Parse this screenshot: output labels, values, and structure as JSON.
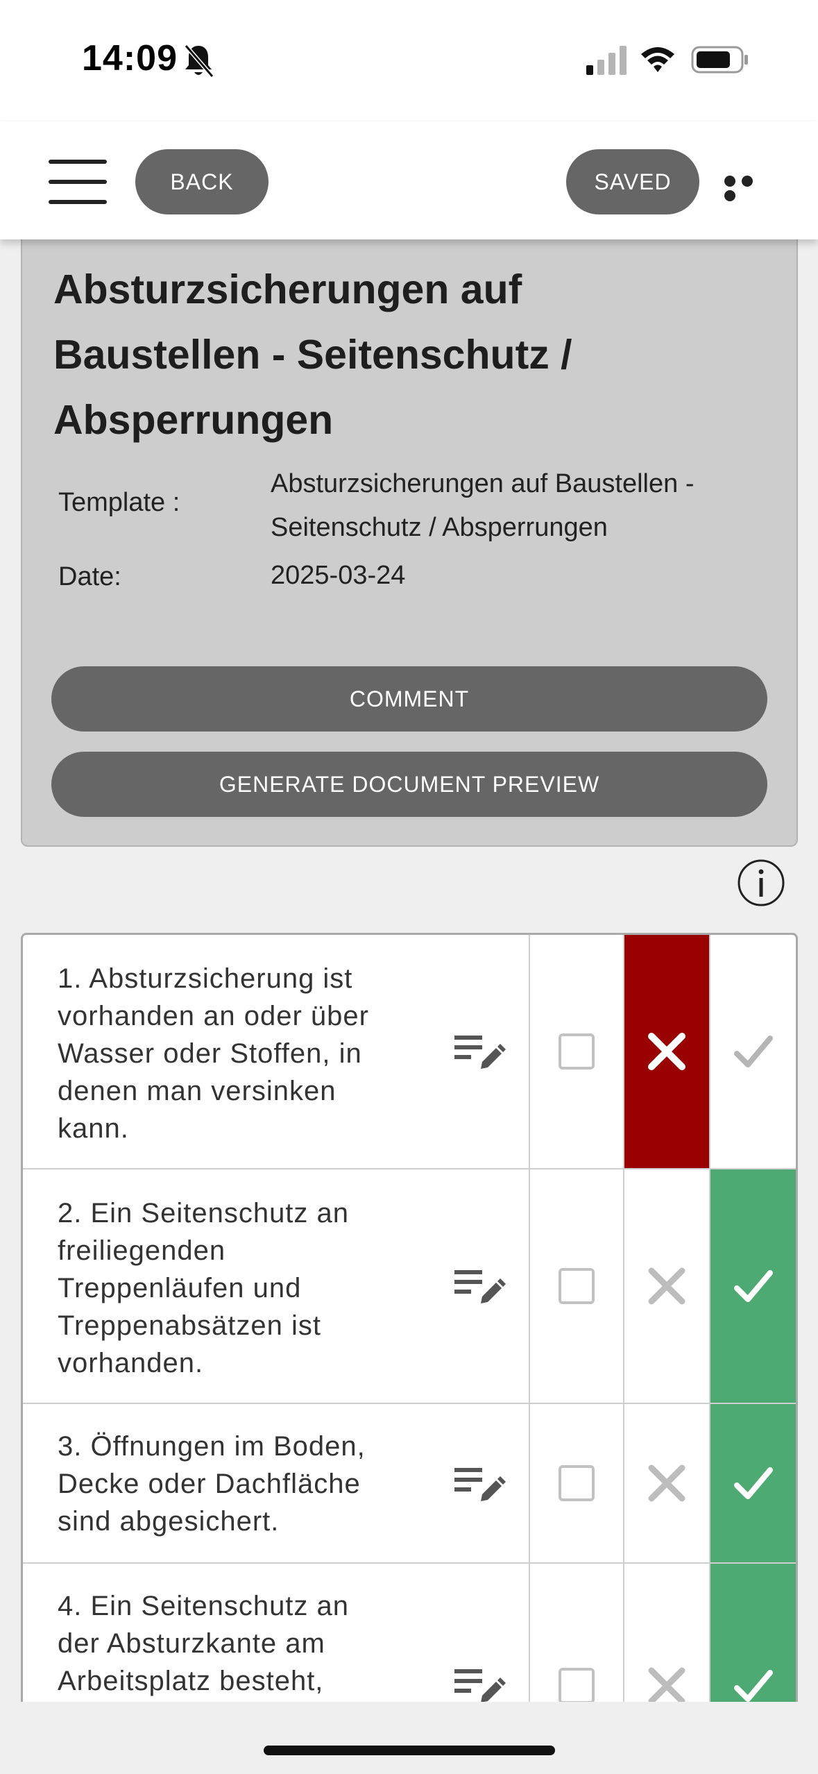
{
  "status_bar": {
    "time": "14:09",
    "icons": [
      "bell-slash-icon",
      "signal-icon",
      "wifi-icon",
      "battery-icon"
    ]
  },
  "nav": {
    "back_label": "BACK",
    "saved_label": "SAVED",
    "menu_icon": "hamburger-menu-icon",
    "more_icon": "more-dots-icon"
  },
  "document": {
    "title_lines": [
      "Absturzsicherungen auf",
      "Baustellen - Seitenschutz /",
      "Absperrungen"
    ],
    "template_label": "Template :",
    "template_value_lines": [
      "Absturzsicherungen auf Baustellen -",
      "Seitenschutz / Absperrungen"
    ],
    "date_label": "Date:",
    "date_value": "2025-03-24",
    "comment_label": "COMMENT",
    "preview_label": "GENERATE DOCUMENT PREVIEW"
  },
  "colors": {
    "button_gray": "#666666",
    "fail_red": "#990000",
    "pass_green": "#4caa72",
    "card_gray": "#cdcdcd"
  },
  "checklist": {
    "items": [
      {
        "lines": [
          "1. Absturzsicherung ist",
          "vorhanden an oder über",
          "Wasser oder Stoffen, in",
          "denen man versinken",
          "kann."
        ],
        "status": "fail"
      },
      {
        "lines": [
          "2. Ein Seitenschutz an",
          "freiliegenden",
          "Treppenläufen und",
          "Treppenabsätzen ist",
          "vorhanden."
        ],
        "status": "pass"
      },
      {
        "lines": [
          "3. Öffnungen im Boden,",
          "Decke oder Dachfläche",
          "sind abgesichert."
        ],
        "status": "pass"
      },
      {
        "lines": [
          "4. Ein Seitenschutz an",
          "der Absturzkante am",
          "Arbeitsplatz besteht,"
        ],
        "status": "pass"
      }
    ]
  }
}
